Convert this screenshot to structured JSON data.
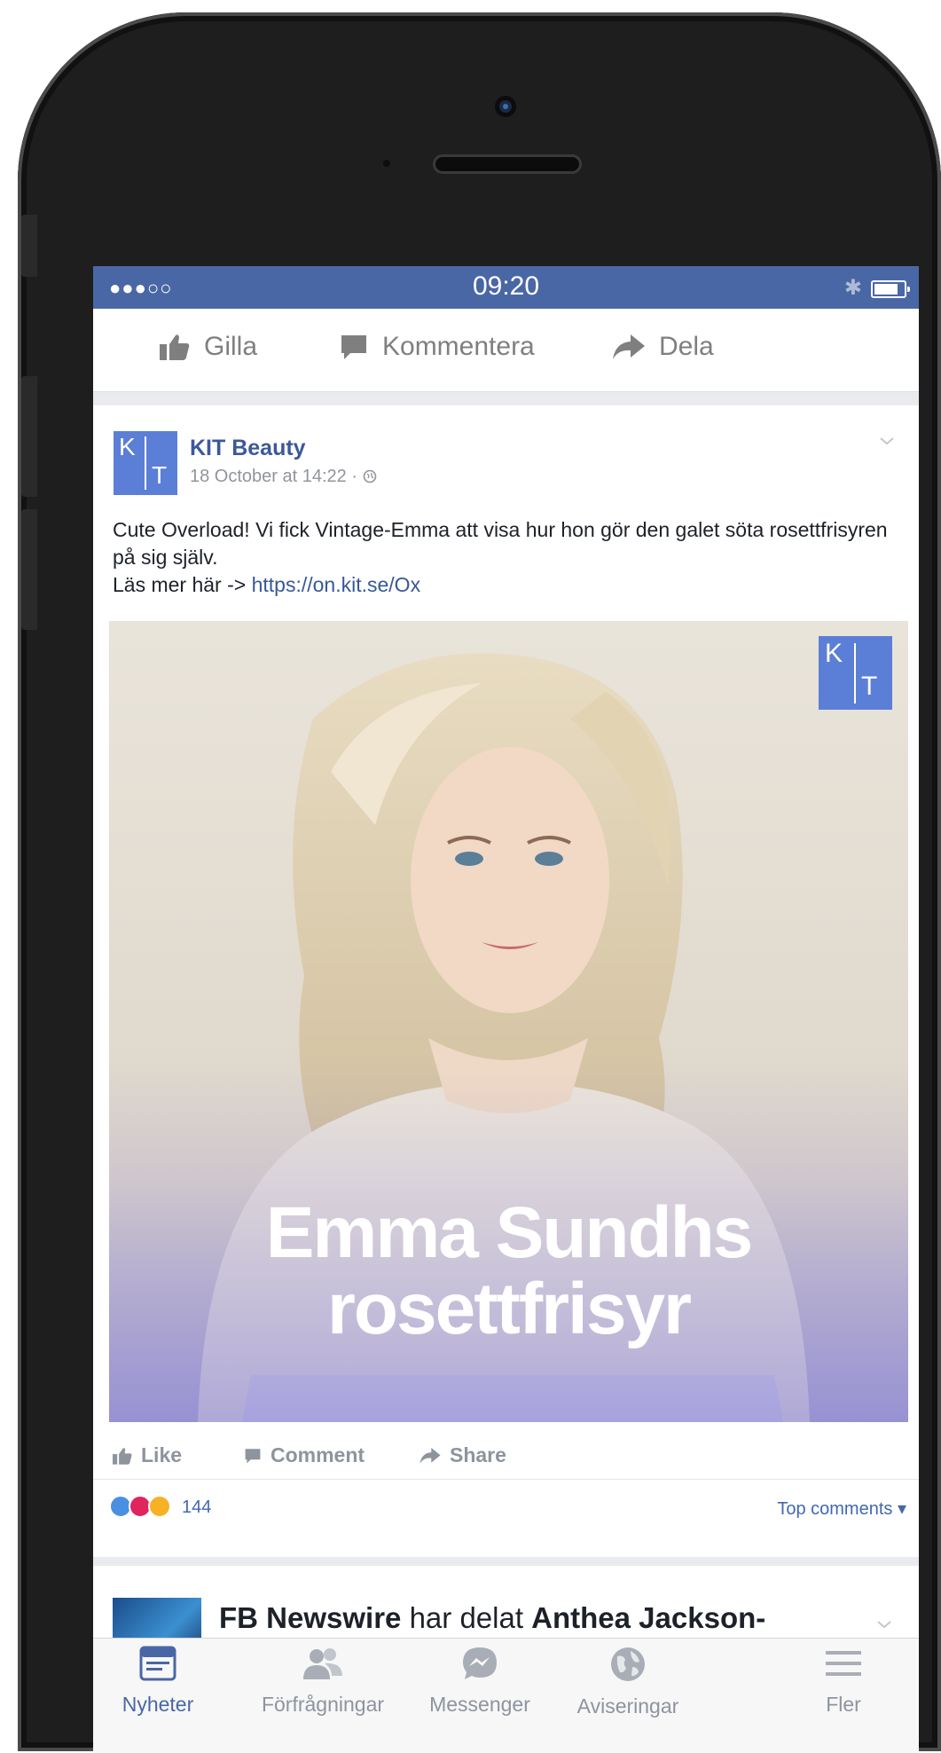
{
  "statusbar": {
    "signal": "●●●○○",
    "time": "09:20",
    "bluetooth": "✱"
  },
  "actions": {
    "like": "Gilla",
    "comment": "Kommentera",
    "share": "Dela"
  },
  "post": {
    "page_name": "KIT Beauty",
    "meta": "18 October at 14:22 · ",
    "text": "Cute Overload! Vi fick Vintage-Emma att visa hur hon gör den galet söta rosettfrisyren på sig själv.",
    "read_more_prefix": "Läs mer här -> ",
    "link": "https://on.kit.se/Ox",
    "avatar_k": "K",
    "avatar_t": "T",
    "video_title_line1": "Emma Sundhs",
    "video_title_line2": "rosettfrisyr"
  },
  "footer_actions": {
    "like": "Like",
    "comment": "Comment",
    "share": "Share"
  },
  "reactions": {
    "count": "144",
    "sort": "Top comments ▾",
    "colors": [
      "#4a90e2",
      "#e0245e",
      "#f7b125"
    ]
  },
  "next_post": {
    "name": "FB Newswire",
    "verb": " har delat ",
    "target": "Anthea Jackson-"
  },
  "tabs": [
    {
      "label": "Nyheter",
      "icon": "news-feed-icon",
      "active": true
    },
    {
      "label": "Förfrågningar",
      "icon": "friend-requests-icon",
      "active": false
    },
    {
      "label": "Messenger",
      "icon": "messenger-icon",
      "active": false
    },
    {
      "label": "Aviseringar",
      "icon": "globe-icon",
      "active": false
    },
    {
      "label": "Fler",
      "icon": "menu-icon",
      "active": false
    }
  ],
  "colors": {
    "facebook_blue": "#4a67a5",
    "link_blue": "#365899",
    "brand_kit": "#5b7fd6"
  }
}
